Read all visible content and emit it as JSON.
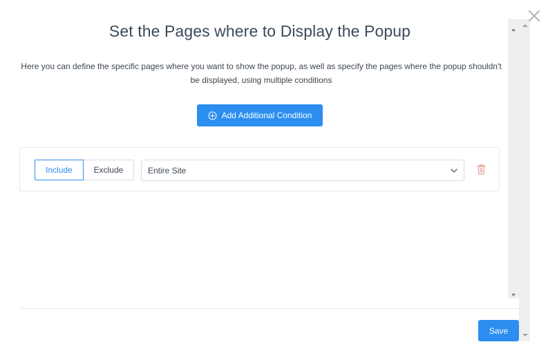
{
  "dialog": {
    "title": "Set the Pages where to Display the Popup",
    "description": "Here you can define the specific pages where you want to show the popup, as well as specify the pages where the popup shouldn't be displayed, using multiple conditions",
    "add_button_label": "Add Additional Condition",
    "save_button_label": "Save",
    "close_icon": "close-icon"
  },
  "condition": {
    "include_label": "Include",
    "exclude_label": "Exclude",
    "selected_mode": "Include",
    "select_value": "Entire Site",
    "delete_icon": "trash-icon"
  },
  "colors": {
    "accent": "#2c8ef0",
    "delete": "#e8a39c",
    "title_text": "#3b4a5a"
  }
}
